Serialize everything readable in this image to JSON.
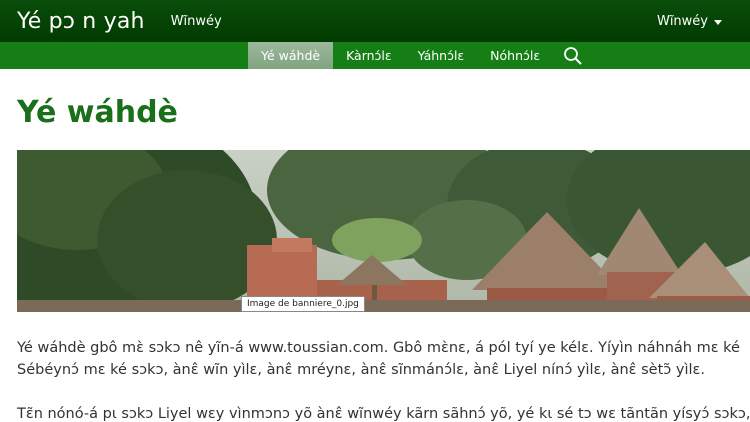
{
  "topbar": {
    "site_title": "Yé pɔ n yah",
    "link": "Wĩnwéy",
    "right_menu": "Wĩnwéy"
  },
  "nav": {
    "items": [
      "Yé wáhdè",
      "Kàrnɔ́lɛ",
      "Yáhnɔ́lɛ",
      "Nóhnɔ́lɛ"
    ],
    "active_index": 0,
    "search_icon": "search-icon"
  },
  "page": {
    "title": "Yé wáhdè",
    "banner_tooltip": "Image de banniere_0.jpg",
    "paragraph_1_line_1": "Yé wáhdè gbô mɛ̀ sɔkɔ nê yĩn-á www.toussian.com. Gbô mɛ̀nɛ, á pól tyí ye kélɛ. Yíyìn náhnáh mɛ ké",
    "paragraph_1_line_2": "Sébéynɔ́ mɛ ké sɔkɔ, ànɛ̂ wĩn yìlɛ, ànɛ̂ mréynɛ, ànɛ̂ sĩnmánɔ́lɛ, ànɛ̂ Liyel nínɔ́ yìlɛ, ànɛ̂ sètɔ̃ yìlɛ.",
    "paragraph_2_line_1": "Tɛ̃n nónó-á pɩ sɔkɔ Liyel wɛy vìnmɔnɔ yõ ànɛ̂ wĩnwéy kãrn sãhnɔ́ yõ, yé kɩ sé tɔ wɛ tãntãn yísyɔ́ sɔkɔ,"
  },
  "colors": {
    "topbar": "#003b00",
    "navbar": "#157f15",
    "title": "#1a6f1a"
  }
}
